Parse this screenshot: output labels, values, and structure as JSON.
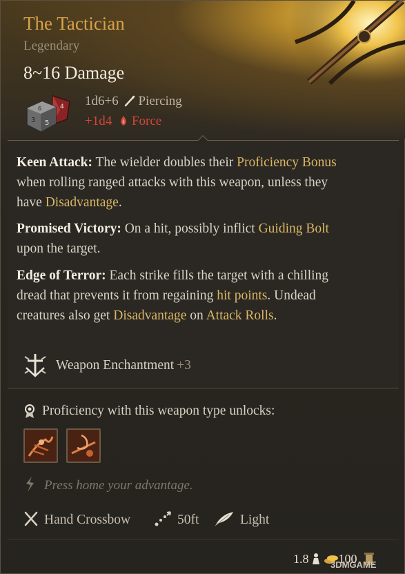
{
  "item": {
    "name": "The Tactician",
    "rarity": "Legendary",
    "damage_total": "8~16 Damage",
    "base_damage": {
      "dice": "1d6+6",
      "type": "Piercing",
      "icon": "piercing-icon"
    },
    "bonus_damage": {
      "dice": "+1d4",
      "type": "Force",
      "icon": "force-icon"
    },
    "colors": {
      "title": "#d6a24a",
      "force": "#d6463a",
      "keyword": "#d9b665",
      "legendary_glow": "#f3d36a"
    }
  },
  "passives": [
    {
      "name": "Keen Attack:",
      "text_parts": [
        " The wielder doubles their ",
        "Proficiency Bonus",
        " when rolling ranged attacks with this weapon, unless they have ",
        "Disadvantage",
        "."
      ]
    },
    {
      "name": "Promised Victory:",
      "text_parts": [
        " On a hit, possibly inflict ",
        "Guiding Bolt",
        " upon the target."
      ]
    },
    {
      "name": "Edge of Terror:",
      "text_parts": [
        " Each strike fills the target with a chilling dread that prevents it from regaining ",
        "hit points",
        ". Undead creatures also get ",
        "Disadvantage",
        " on ",
        "Attack Rolls",
        "."
      ]
    }
  ],
  "enchantment": {
    "label": "Weapon Enchantment",
    "bonus": "+3",
    "icon": "enchantment-icon"
  },
  "proficiency": {
    "label": "Proficiency with this weapon type unlocks:",
    "icon": "proficiency-medal-icon",
    "actions": [
      {
        "name": "action-icon-1"
      },
      {
        "name": "action-icon-2"
      }
    ],
    "hint": "Press home your advantage."
  },
  "properties": {
    "weapon_type": "Hand Crossbow",
    "range": "50ft",
    "weight_class": "Light"
  },
  "footer": {
    "weight": "1.8",
    "value": "100",
    "watermark": "3DMGAME"
  }
}
